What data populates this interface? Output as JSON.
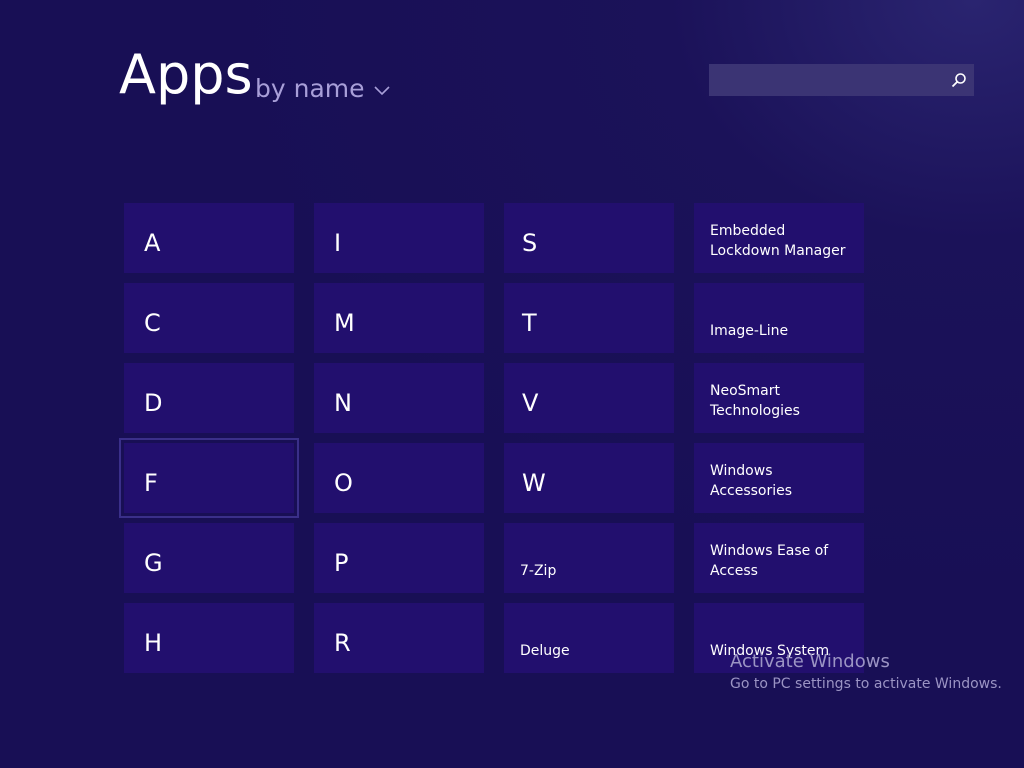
{
  "header": {
    "title": "Apps",
    "sort_label": "by name"
  },
  "search": {
    "value": "",
    "placeholder": ""
  },
  "columns": {
    "col1": [
      "A",
      "C",
      "D",
      "F",
      "G",
      "H"
    ],
    "col2": [
      "I",
      "M",
      "N",
      "O",
      "P",
      "R"
    ],
    "col3": [
      "S",
      "T",
      "V",
      "W",
      "7-Zip",
      "Deluge"
    ],
    "col4": [
      "Embedded Lockdown Manager",
      "Image-Line",
      "NeoSmart Technologies",
      "Windows Accessories",
      "Windows Ease of Access",
      "Windows System"
    ]
  },
  "selected_tile": "F",
  "watermark": {
    "title": "Activate Windows",
    "subtitle": "Go to PC settings to activate Windows."
  },
  "colors": {
    "background": "#180f55",
    "tile": "#220f6e",
    "accent_text": "#a89fd8",
    "search_box": "#3b3474"
  }
}
